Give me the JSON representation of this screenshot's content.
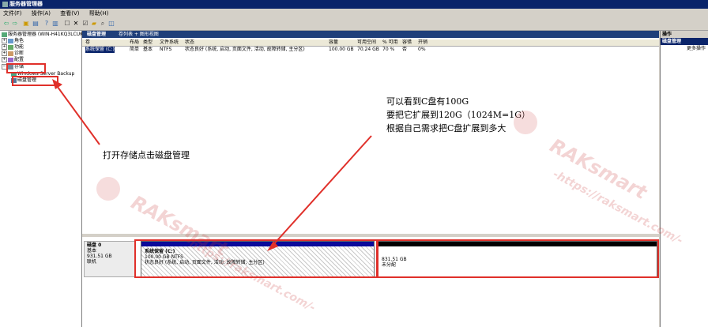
{
  "window": {
    "title": "服务器管理器"
  },
  "menu": [
    "文件(F)",
    "操作(A)",
    "查看(V)",
    "帮助(H)"
  ],
  "toolbar": {
    "icons": [
      "back-arrow-icon",
      "forward-arrow-icon",
      "folder-up-icon",
      "console-icon",
      "help-icon",
      "console-icon-2",
      "properties-icon",
      "delete-icon",
      "properties-icon-2",
      "folder-icon",
      "search-icon",
      "disk-icon"
    ]
  },
  "tree": {
    "root": "服务器管理器 (WIN-H41KQ3LCUK",
    "items": [
      "角色",
      "功能",
      "诊断",
      "配置",
      "存储"
    ],
    "storage_children": [
      "Windows Server Backup",
      "磁盘管理"
    ]
  },
  "center": {
    "tab_title": "磁盘管理",
    "tab_subtitle": "卷列表 + 图形视图",
    "columns": [
      "卷",
      "布局",
      "类型",
      "文件系统",
      "状态",
      "容量",
      "可用空间",
      "% 可用",
      "容错",
      "开销"
    ],
    "volume_row": [
      "系统保留 (C:)",
      "简单",
      "基本",
      "NTFS",
      "状态良好 (系统, 启动, 页面文件, 活动, 故障转储, 主分区)",
      "100.00 GB",
      "70.24 GB",
      "70 %",
      "否",
      "0%"
    ]
  },
  "disk": {
    "name": "磁盘 0",
    "type": "基本",
    "size": "931.51 GB",
    "status": "联机",
    "partition_c": {
      "label": "系统保留  (C:)",
      "size": "100.00 GB NTFS",
      "status": "状态良好 (系统, 启动, 页面文件, 活动, 故障转储, 主分区)"
    },
    "unallocated": {
      "size": "831.51 GB",
      "label": "未分配"
    }
  },
  "actions": {
    "header": "操作",
    "selected": "磁盘管理",
    "more": "更多操作"
  },
  "annotations": {
    "left": "打开存储点击磁盘管理",
    "right_lines": [
      "可以看到C盘有100G",
      "要把它扩展到120G（1024M=1G）",
      "根据自己需求把C盘扩展到多大"
    ]
  },
  "watermark": {
    "text1": "RAKsmart",
    "text2": "-https://raksmart.com/-"
  },
  "colors": {
    "annotation_red": "#e0302a",
    "title_blue": "#0a246a"
  }
}
